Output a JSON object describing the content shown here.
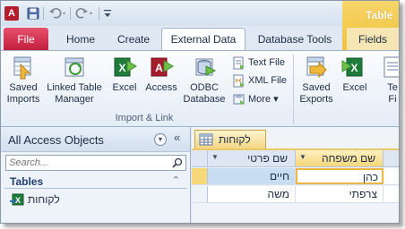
{
  "quick_access": {
    "app_icon_letter": "A",
    "icons": [
      "save-icon",
      "undo-icon",
      "redo-icon",
      "customize-toolbar-icon"
    ]
  },
  "context_tab": {
    "label": "Table"
  },
  "tabs": {
    "file": "File",
    "home": "Home",
    "create": "Create",
    "external_data": "External Data",
    "database_tools": "Database Tools",
    "fields": "Fields"
  },
  "ribbon": {
    "saved_imports": {
      "line1": "Saved",
      "line2": "Imports"
    },
    "linked_table_manager": {
      "line1": "Linked Table",
      "line2": "Manager"
    },
    "excel": "Excel",
    "access": "Access",
    "odbc": {
      "line1": "ODBC",
      "line2": "Database"
    },
    "text_file": "Text File",
    "xml_file": "XML File",
    "more": "More ▾",
    "group_label": "Import & Link",
    "saved_exports": {
      "line1": "Saved",
      "line2": "Exports"
    },
    "excel_export": "Excel",
    "export_text": {
      "line1": "Te",
      "line2": "Fi"
    }
  },
  "nav_pane": {
    "title": "All Access Objects",
    "search_placeholder": "Search...",
    "group_label": "Tables",
    "item_label": "לקוחות"
  },
  "document": {
    "tab_label": "לקוחות",
    "columns": {
      "last_name": "שם משפחה",
      "first_name": "שם פרטי"
    },
    "rows": [
      {
        "last_name": "כהן",
        "first_name": "חיים"
      },
      {
        "last_name": "צרפתי",
        "first_name": "משה"
      }
    ]
  },
  "colors": {
    "file_tab": "#c2203d",
    "accent_yellow": "#f6d77a",
    "selection_blue": "#c9ddf2"
  }
}
